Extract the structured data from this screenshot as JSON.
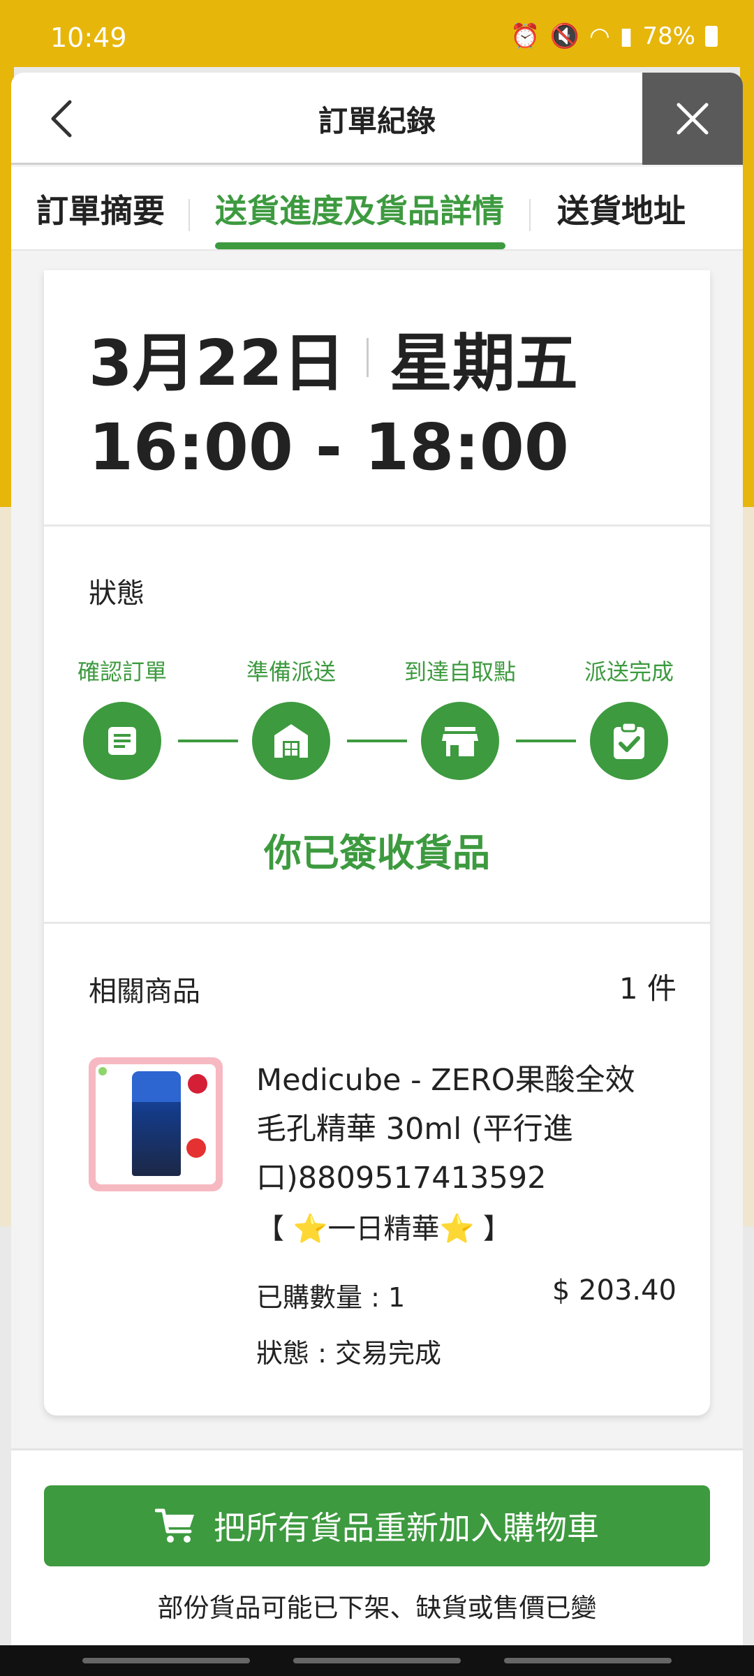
{
  "status_bar": {
    "time": "10:49",
    "battery": "78%"
  },
  "header": {
    "title": "訂單紀錄"
  },
  "tabs": [
    {
      "label": "訂單摘要"
    },
    {
      "label": "送貨進度及貨品詳情"
    },
    {
      "label": "送貨地址"
    }
  ],
  "delivery": {
    "date": "3月22日",
    "weekday": "星期五",
    "time_range": "16:00 - 18:00"
  },
  "status": {
    "label": "狀態",
    "steps": [
      "確認訂單",
      "準備派送",
      "到達自取點",
      "派送完成"
    ],
    "message": "你已簽收貨品"
  },
  "products": {
    "label": "相關商品",
    "count": "1 件",
    "items": [
      {
        "name": "Medicube - ZERO果酸全效毛孔精華 30ml (平行進口)8809517413592",
        "tag": "【 ⭐一日精華⭐ 】",
        "quantity": "已購數量 : 1",
        "price": "$ 203.40",
        "status": "狀態 : 交易完成"
      }
    ]
  },
  "actions": {
    "readd_label": "把所有貨品重新加入購物車",
    "disclaimer": "部份貨品可能已下架、缺貨或售價已變"
  },
  "colors": {
    "accent": "#3d9a3f",
    "status_bar": "#e7b60b"
  }
}
